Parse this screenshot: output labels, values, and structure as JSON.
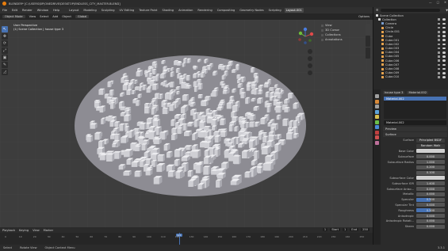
{
  "titlebar": {
    "title": "BLENDER* [C:\\USERS\\BP\\ONEDRIVE\\DESKTOP\\ENDLESS_CITY_MASTER.BLEND]",
    "controls": [
      "—",
      "□",
      "✕"
    ]
  },
  "menubar": {
    "items": [
      "File",
      "Edit",
      "Render",
      "Window",
      "Help"
    ],
    "workspaces": [
      "Layout",
      "Modeling",
      "Sculpting",
      "UV Editing",
      "Texture Paint",
      "Shading",
      "Animation",
      "Rendering",
      "Compositing",
      "Geometry Nodes",
      "Scripting",
      "Layout.001"
    ],
    "active_workspace": "Layout.001",
    "scene": "Scene",
    "view_layer": "ViewLayer"
  },
  "viewport_header": {
    "mode": "Object Mode",
    "menus": [
      "View",
      "Select",
      "Add",
      "Object"
    ],
    "transform": "Global",
    "options": "Options"
  },
  "viewport": {
    "info_line1": "User Perspective",
    "info_line2": "(1) Scene Collection | house type 3",
    "side_panel_items": [
      "View",
      "3D Cursor",
      "Collections",
      "Annotations"
    ],
    "background": "#3d3d3d",
    "disc_color": "#8d8c93",
    "building_color": "#d8d8dc"
  },
  "tools": [
    "↖",
    "✥",
    "⟳",
    "⤢",
    "▣",
    "✎",
    "◿"
  ],
  "timeline": {
    "menus": [
      "Playback",
      "Keying",
      "View",
      "Marker"
    ],
    "current_frame": "1",
    "start_label": "Start",
    "start": "1",
    "end_label": "End",
    "end": "250",
    "ticks": [
      "0",
      "10",
      "20",
      "30",
      "40",
      "50",
      "60",
      "70",
      "80",
      "90",
      "100",
      "110",
      "120",
      "130",
      "140",
      "150",
      "160",
      "170",
      "180",
      "190",
      "200",
      "210",
      "220",
      "230",
      "240",
      "250"
    ],
    "cursor_label": "121"
  },
  "statusbar": {
    "items": [
      "Select",
      "Rotate View",
      "Object Context Menu"
    ],
    "version": "3.3.1"
  },
  "outliner": {
    "rows": [
      {
        "label": "Scene Collection",
        "color": "#d8d8d8"
      },
      {
        "label": "Collection",
        "color": "#d8d8d8"
      },
      {
        "label": "Camera",
        "color": "#7a9fd1"
      },
      {
        "label": "Circle",
        "color": "#e8a44e"
      },
      {
        "label": "Circle.001",
        "color": "#e8a44e"
      },
      {
        "label": "Cube",
        "color": "#e8a44e"
      },
      {
        "label": "Cube.001",
        "color": "#e8a44e"
      },
      {
        "label": "Cube.002",
        "color": "#e8a44e"
      },
      {
        "label": "Cube.003",
        "color": "#e8a44e"
      },
      {
        "label": "Cube.004",
        "color": "#e8a44e"
      },
      {
        "label": "Cube.005",
        "color": "#e8a44e"
      },
      {
        "label": "Cube.006",
        "color": "#e8a44e"
      },
      {
        "label": "Cube.007",
        "color": "#e8a44e"
      },
      {
        "label": "Cube.008",
        "color": "#e8a44e"
      },
      {
        "label": "Cube.009",
        "color": "#e8a44e"
      },
      {
        "label": "Cube.010",
        "color": "#e8a44e"
      }
    ]
  },
  "properties": {
    "object": "house type 3",
    "material_tab": "Material.002",
    "slot": "Material.002",
    "material_name": "Material.002",
    "sections": {
      "preview": "Preview",
      "surface": "Surface"
    },
    "surface_label": "Surface",
    "surface_value": "Principled BSDF",
    "subsurface_method": "Random Walk",
    "rows": [
      {
        "label": "Base Color",
        "value": "",
        "type": "color"
      },
      {
        "label": "Subsurface",
        "value": "0.000",
        "type": "num",
        "fill": 0
      },
      {
        "label": "Subsurface Radius",
        "value": "1.000",
        "type": "num",
        "fill": 0
      },
      {
        "label": "",
        "value": "0.200",
        "type": "num",
        "fill": 0
      },
      {
        "label": "",
        "value": "0.100",
        "type": "num",
        "fill": 0
      },
      {
        "label": "Subsurface Color",
        "value": "",
        "type": "color"
      },
      {
        "label": "Subsurface IOR",
        "value": "1.400",
        "type": "num",
        "fill": 0
      },
      {
        "label": "Subsurface Aniso...",
        "value": "0.000",
        "type": "num",
        "fill": 0
      },
      {
        "label": "Metallic",
        "value": "0.000",
        "type": "num",
        "fill": 0
      },
      {
        "label": "Specular",
        "value": "0.500",
        "type": "num",
        "fill": 0.5
      },
      {
        "label": "Specular Tint",
        "value": "0.000",
        "type": "num",
        "fill": 0
      },
      {
        "label": "Roughness",
        "value": "0.500",
        "type": "num",
        "fill": 0.5
      },
      {
        "label": "Anisotropic",
        "value": "0.000",
        "type": "num",
        "fill": 0
      },
      {
        "label": "Anisotropic Rotati...",
        "value": "0.000",
        "type": "num",
        "fill": 0
      },
      {
        "label": "Sheen",
        "value": "0.000",
        "type": "num",
        "fill": 0
      }
    ]
  }
}
